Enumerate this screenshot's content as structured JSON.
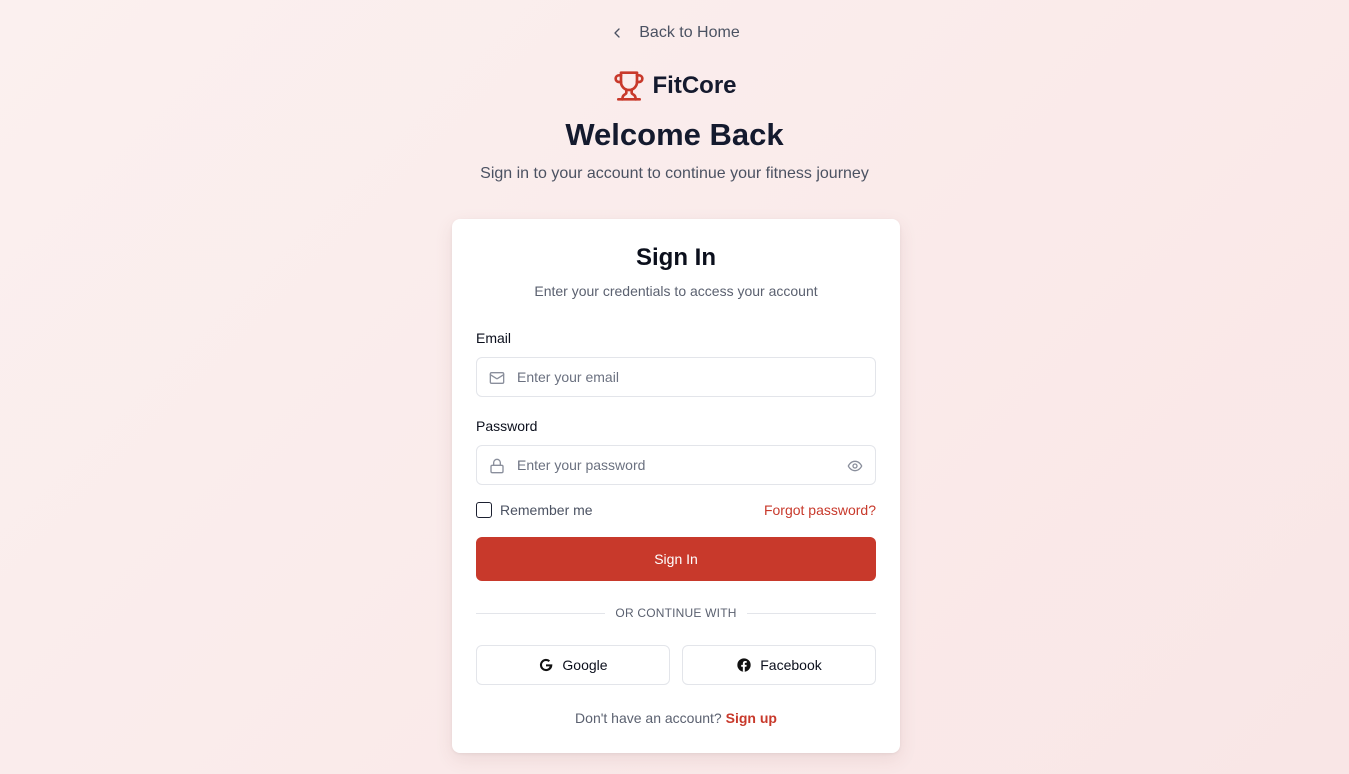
{
  "nav": {
    "back_label": "Back to Home"
  },
  "brand": {
    "name": "FitCore",
    "icon": "trophy-icon",
    "accent_color": "#c8392b"
  },
  "hero": {
    "title": "Welcome Back",
    "subtitle": "Sign in to your account to continue your fitness journey"
  },
  "card": {
    "title": "Sign In",
    "subtitle": "Enter your credentials to access your account",
    "email": {
      "label": "Email",
      "placeholder": "Enter your email",
      "value": "",
      "icon": "mail-icon"
    },
    "password": {
      "label": "Password",
      "placeholder": "Enter your password",
      "value": "",
      "icon": "lock-icon",
      "toggle_icon": "eye-icon"
    },
    "remember_label": "Remember me",
    "remember_checked": false,
    "forgot_label": "Forgot password?",
    "submit_label": "Sign In",
    "divider_text": "OR CONTINUE WITH",
    "social": {
      "google_label": "Google",
      "facebook_label": "Facebook"
    },
    "signup_prompt": "Don't have an account?",
    "signup_link": "Sign up"
  }
}
